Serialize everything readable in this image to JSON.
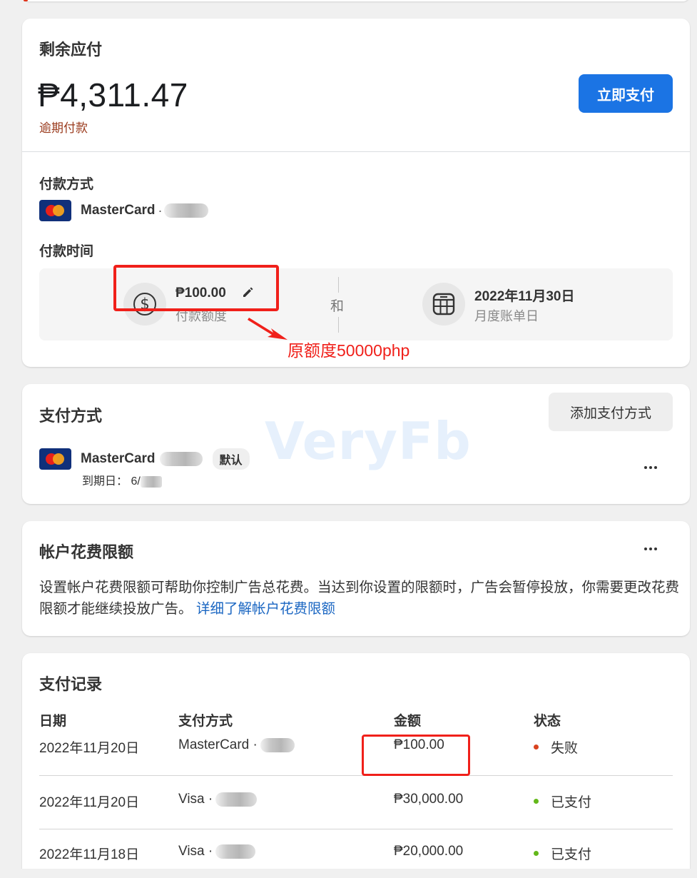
{
  "balance_card": {
    "title": "剩余应付",
    "amount": "₱4,311.47",
    "status": "逾期付款",
    "pay_now_label": "立即支付",
    "payment_method_label": "付款方式",
    "payment_method": {
      "brand": "MasterCard",
      "separator": "·",
      "logo_icon": "mastercard-logo-icon"
    },
    "payment_time_label": "付款时间",
    "threshold": {
      "amount": "₱100.00",
      "label": "付款额度",
      "icon": "dollar-circle-icon",
      "edit_icon": "pencil-icon"
    },
    "and_label": "和",
    "billing_date": {
      "date": "2022年11月30日",
      "label": "月度账单日",
      "icon": "calendar-icon"
    },
    "annotation": "原额度50000php"
  },
  "payment_methods_card": {
    "title": "支付方式",
    "add_label": "添加支付方式",
    "watermark": "VeryFb",
    "method": {
      "brand": "MasterCard",
      "default_badge": "默认",
      "expiry": "到期日： 6/"
    },
    "more_icon": "more-horizontal-icon"
  },
  "spending_limit_card": {
    "title": "帐户花费限额",
    "description": "设置帐户花费限额可帮助你控制广告总花费。当达到你设置的限额时，广告会暂停投放，你需要更改花费限额才能继续投放广告。",
    "learn_more": "详细了解帐户花费限额",
    "more_icon": "more-horizontal-icon"
  },
  "payment_history": {
    "title": "支付记录",
    "columns": [
      "日期",
      "支付方式",
      "金额",
      "状态"
    ],
    "rows": [
      {
        "date": "2022年11月20日",
        "method": "MasterCard ·",
        "amount": "₱100.00",
        "status": "失败",
        "status_color": "#d9431f"
      },
      {
        "date": "2022年11月20日",
        "method": "Visa ·",
        "amount": "₱30,000.00",
        "status": "已支付",
        "status_color": "#63b81a"
      },
      {
        "date": "2022年11月18日",
        "method": "Visa ·",
        "amount": "₱20,000.00",
        "status": "已支付",
        "status_color": "#63b81a"
      }
    ]
  },
  "colors": {
    "primary": "#1b74e4",
    "overdue": "#9a3a1c",
    "annotation": "#f0201a",
    "link": "#1a66c2"
  }
}
